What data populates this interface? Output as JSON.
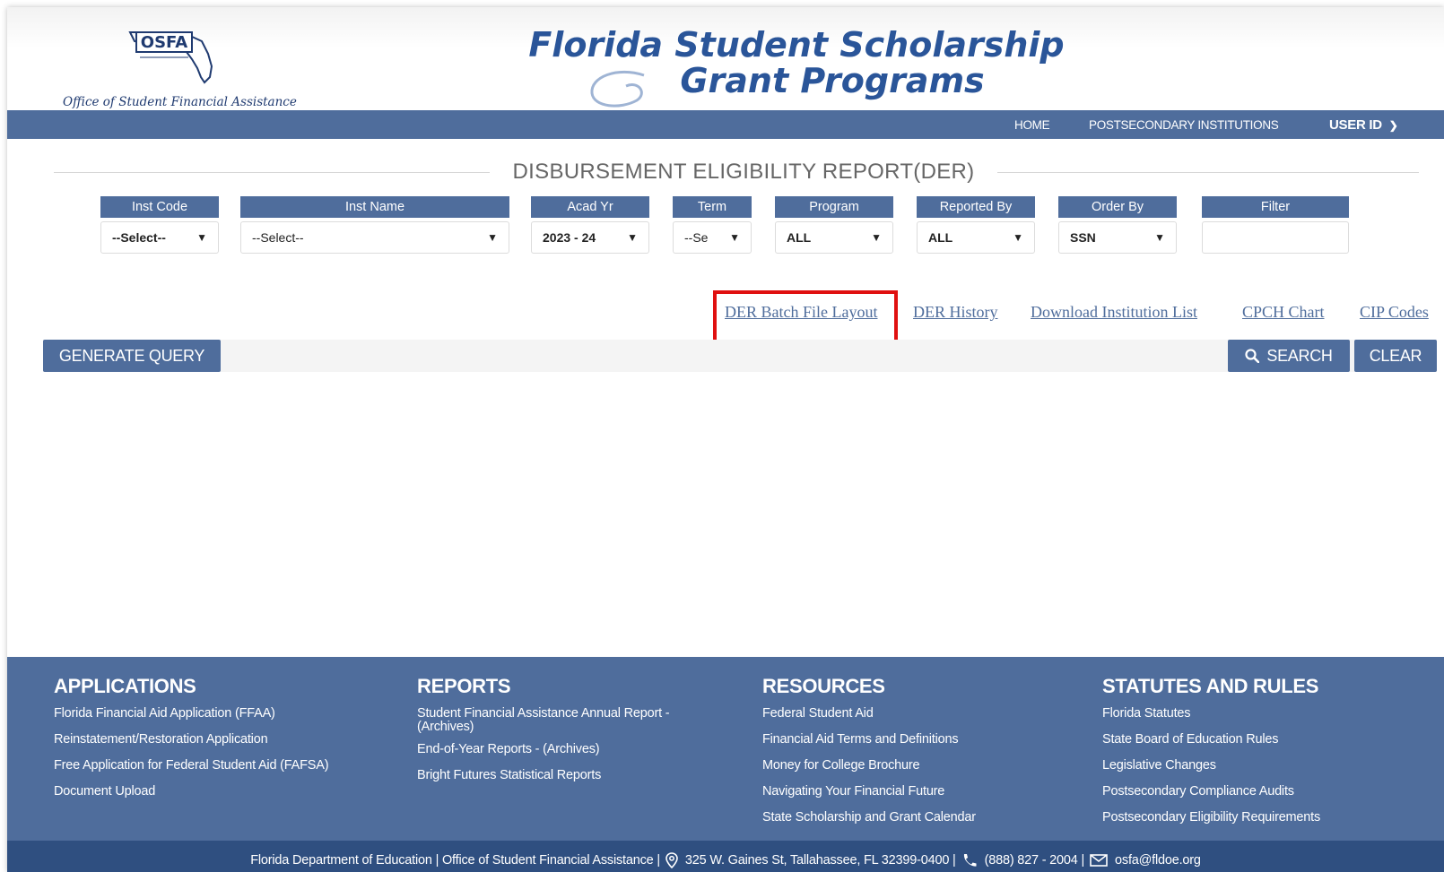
{
  "header": {
    "logo_text": "OSFA",
    "logo_subtitle": "Office of Student Financial Assistance",
    "title_line1": "Florida Student Scholarship",
    "title_line2": "Grant Programs"
  },
  "nav": {
    "home": "HOME",
    "postsecondary": "POSTSECONDARY INSTITUTIONS",
    "user": "USER ID"
  },
  "page_title": "DISBURSEMENT ELIGIBILITY REPORT(DER)",
  "filters": {
    "inst_code": {
      "label": "Inst Code",
      "value": "--Select--"
    },
    "inst_name": {
      "label": "Inst Name",
      "value": "--Select--"
    },
    "acad_yr": {
      "label": "Acad Yr",
      "value": "2023 - 24"
    },
    "term": {
      "label": "Term",
      "value": "--Se"
    },
    "program": {
      "label": "Program",
      "value": "ALL"
    },
    "reported_by": {
      "label": "Reported By",
      "value": "ALL"
    },
    "order_by": {
      "label": "Order By",
      "value": "SSN"
    },
    "filter": {
      "label": "Filter",
      "value": ""
    }
  },
  "links": {
    "der_batch": "DER Batch File Layout",
    "der_history": "DER History",
    "download_inst": "Download Institution List",
    "cpch": "CPCH Chart",
    "cip": "CIP Codes"
  },
  "buttons": {
    "generate": "GENERATE QUERY",
    "search": "SEARCH",
    "clear": "CLEAR"
  },
  "footer": {
    "applications": {
      "title": "APPLICATIONS",
      "items": [
        "Florida Financial Aid Application (FFAA)",
        "Reinstatement/Restoration Application",
        "Free Application for Federal Student Aid (FAFSA)",
        "Document Upload"
      ]
    },
    "reports": {
      "title": "REPORTS",
      "items": [
        "Student Financial Assistance Annual Report - (Archives)",
        "End-of-Year Reports - (Archives)",
        "Bright Futures Statistical Reports"
      ]
    },
    "resources": {
      "title": "RESOURCES",
      "items": [
        "Federal Student Aid",
        "Financial Aid Terms and Definitions",
        "Money for College Brochure",
        "Navigating Your Financial Future",
        "State Scholarship and Grant Calendar"
      ]
    },
    "statutes": {
      "title": "STATUTES AND RULES",
      "items": [
        "Florida Statutes",
        "State Board of Education Rules",
        "Legislative Changes",
        "Postsecondary Compliance Audits",
        "Postsecondary Eligibility Requirements"
      ]
    },
    "bottom": {
      "org": "Florida Department of Education | Office of Student Financial Assistance |",
      "address": "325 W. Gaines St, Tallahassee, FL 32399-0400 |",
      "phone": "(888) 827 - 2004 |",
      "email": "osfa@fldoe.org"
    }
  },
  "colors": {
    "primary": "#4f6d9c",
    "dark": "#2f4f80",
    "highlight": "#e01010"
  }
}
